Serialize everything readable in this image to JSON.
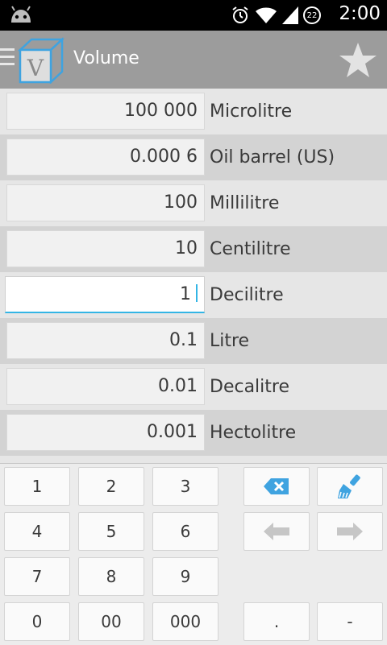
{
  "status_bar": {
    "time": "2:00",
    "battery_level": "22",
    "icons": [
      "android-icon",
      "alarm-icon",
      "wifi-icon",
      "signal-icon",
      "battery-icon"
    ]
  },
  "action_bar": {
    "title": "Volume",
    "logo_letter": "V",
    "icons": [
      "menu-icon",
      "app-logo-cube-icon",
      "star-icon"
    ]
  },
  "units": [
    {
      "value": "100 000",
      "name": "Microlitre"
    },
    {
      "value": "0.000 6",
      "name": "Oil barrel (US)"
    },
    {
      "value": "100",
      "name": "Millilitre"
    },
    {
      "value": "10",
      "name": "Centilitre"
    },
    {
      "value": "1",
      "name": "Decilitre",
      "active": true
    },
    {
      "value": "0.1",
      "name": "Litre"
    },
    {
      "value": "0.01",
      "name": "Decalitre"
    },
    {
      "value": "0.001",
      "name": "Hectolitre"
    }
  ],
  "keypad": {
    "k1": "1",
    "k2": "2",
    "k3": "3",
    "k4": "4",
    "k5": "5",
    "k6": "6",
    "k7": "7",
    "k8": "8",
    "k9": "9",
    "k0": "0",
    "k00": "00",
    "k000": "000",
    "dot": ".",
    "minus": "-",
    "icons": [
      "backspace-icon",
      "clear-brush-icon",
      "arrow-left-icon",
      "arrow-right-icon"
    ]
  },
  "colors": {
    "accent": "#33b5e5",
    "action_bar": "#9c9c9c",
    "row_light": "#e6e6e6",
    "row_dark": "#d3d3d3"
  }
}
